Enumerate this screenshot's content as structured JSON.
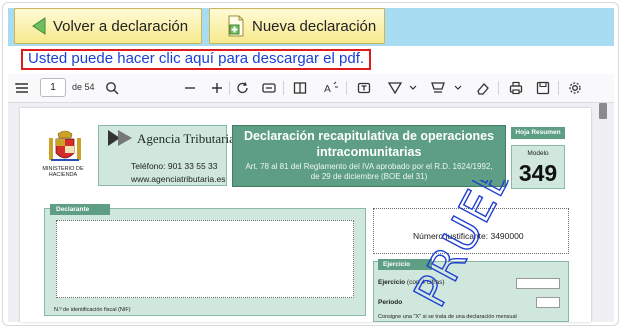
{
  "toolbar": {
    "back_label": "Volver a declaración",
    "new_label": "Nueva declaración"
  },
  "download_link": "Usted puede hacer clic aquí para descargar el pdf.",
  "viewer": {
    "page_current": "1",
    "page_total_text": "de 54"
  },
  "pdf": {
    "ministry": "MINISTERIO DE HACIENDA",
    "agency_name": "Agencia Tributaria",
    "phone": "Teléfono: 901 33 55 33",
    "web": "www.agenciatributaria.es",
    "title_line1": "Declaración recapitulativa de operaciones",
    "title_line2": "intracomunitarias",
    "subtitle": "Art. 78 al 81 del Reglamento del IVA aprobado por el R.D. 1624/1992, de 29 de diciembre (BOE del 31)",
    "hoja": "Hoja Resumen",
    "modelo_label": "Modelo",
    "modelo_number": "349",
    "declarante": "Declarante",
    "nif_label": "N.º de identificación fiscal (NIF)",
    "justificante_label": "Número justificante: 3490000",
    "ejercicio_tab": "Ejercicio",
    "ejercicio_label": "Ejercicio",
    "ejercicio_hint": "(con 4 cifras)",
    "periodo_label": "Período",
    "consigne_text": "Consigne una \"X\" si se trata de una declaración mensual"
  },
  "watermark": "PRUEBAS VALIDACIÓN",
  "colors": {
    "accent_blue_bar": "#a7dcf3",
    "button_yellow": "#f6e98e",
    "link_blue": "#1a3fd8",
    "highlight_red": "#e01b1b",
    "form_green": "#5d9e85",
    "form_light_green": "#cfe7dc"
  }
}
